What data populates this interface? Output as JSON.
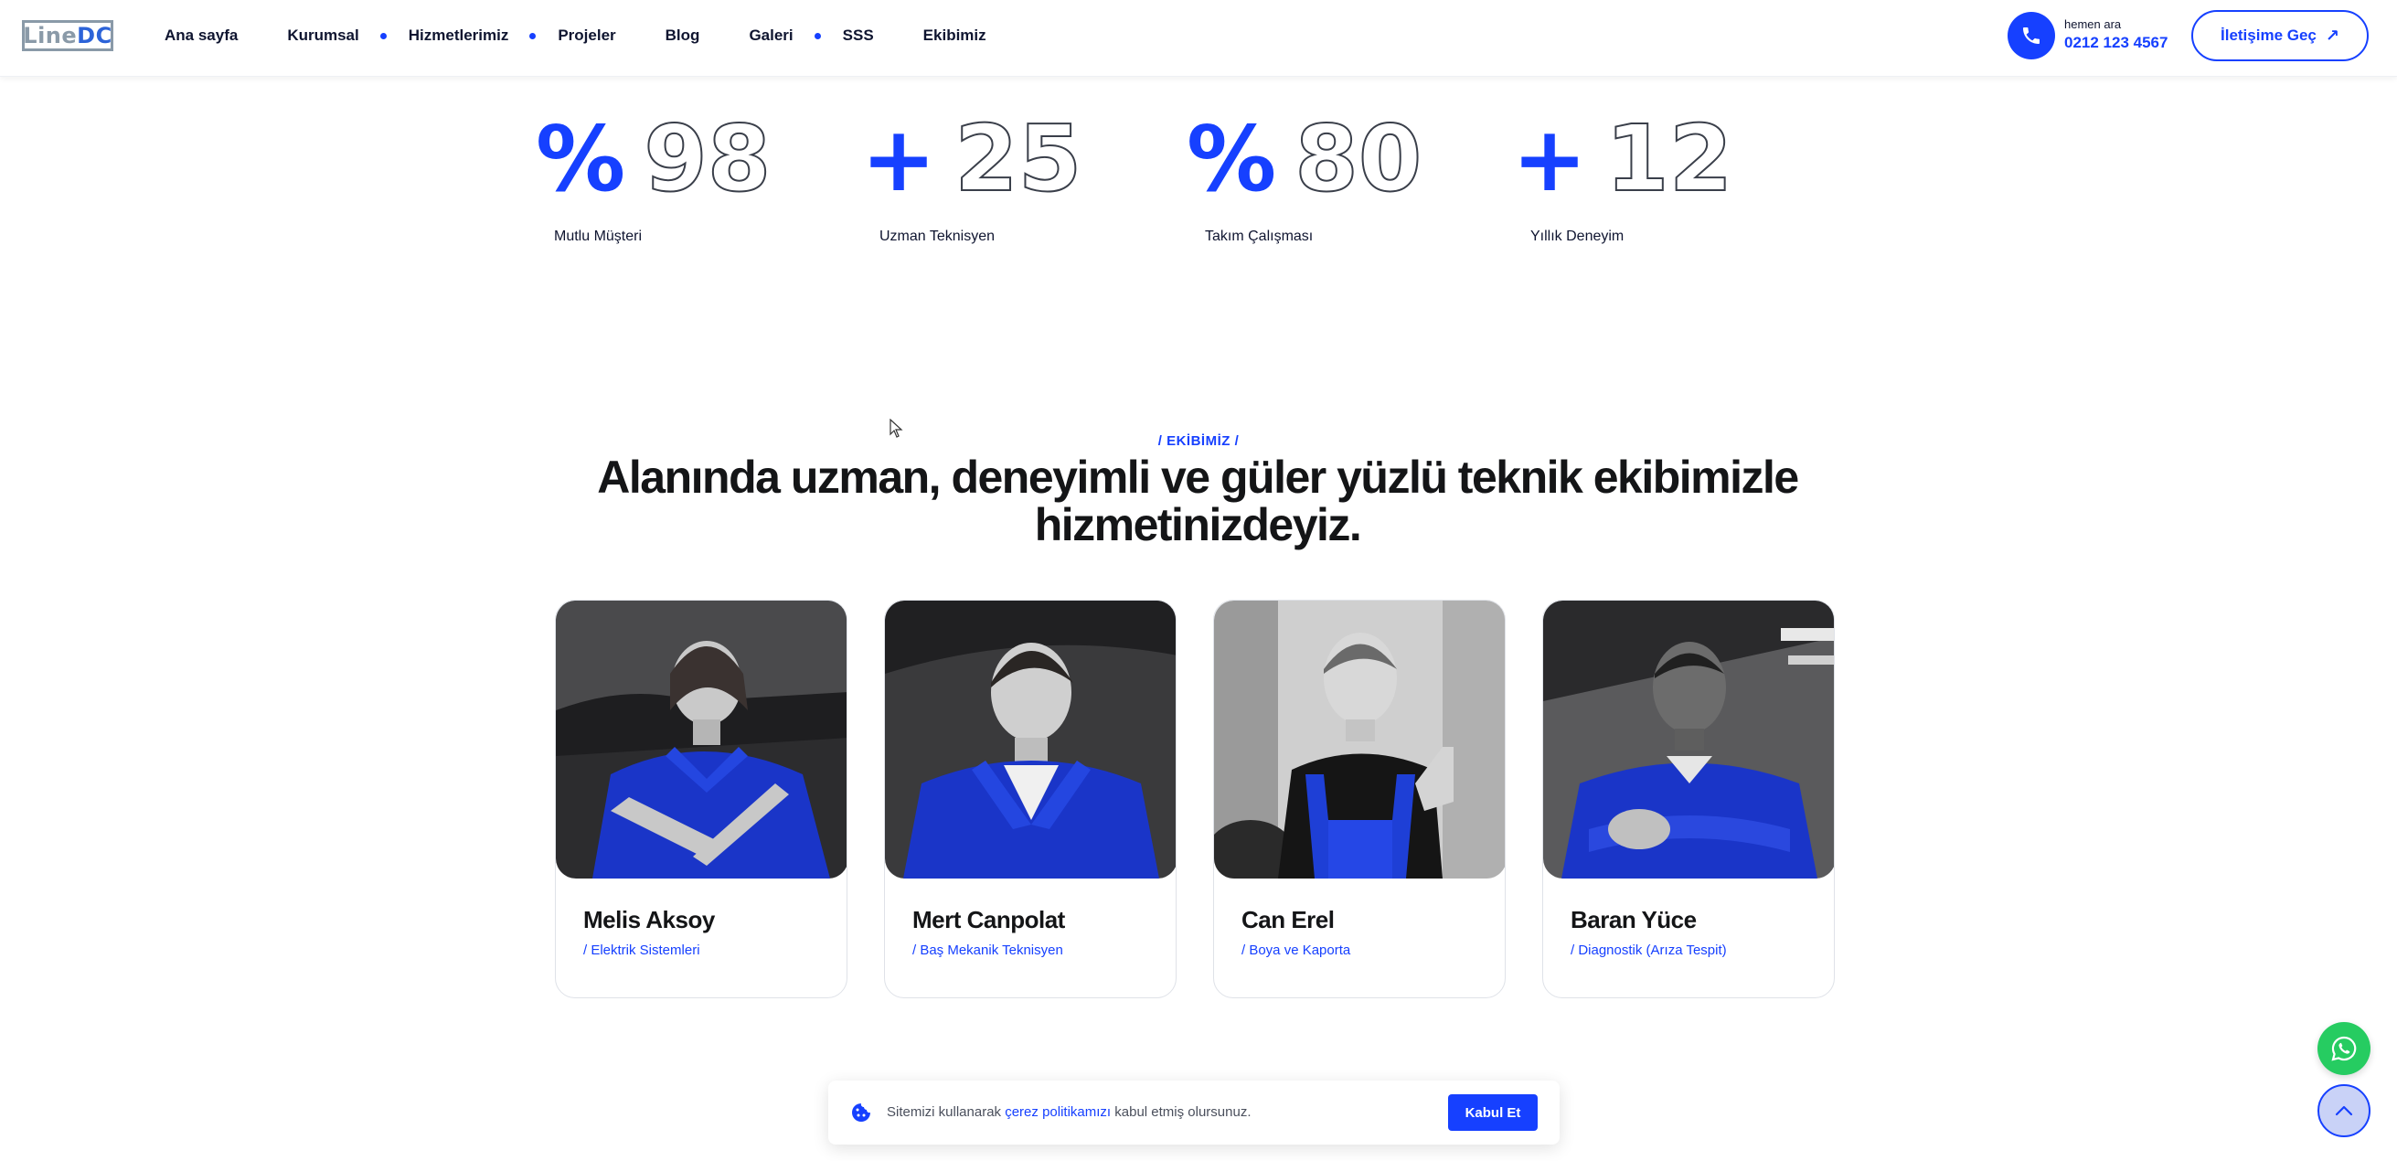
{
  "brand": {
    "logo_part1": "Line",
    "logo_part2": "DC"
  },
  "nav": {
    "items": [
      {
        "label": "Ana sayfa"
      },
      {
        "label": "Kurumsal"
      },
      {
        "label": "Hizmetlerimiz"
      },
      {
        "label": "Projeler"
      },
      {
        "label": "Blog"
      },
      {
        "label": "Galeri"
      },
      {
        "label": "SSS"
      },
      {
        "label": "Ekibimiz"
      }
    ]
  },
  "contact": {
    "call_label": "hemen ara",
    "phone": "0212 123 4567",
    "button_label": "İletişime Geç",
    "button_arrow": "↗"
  },
  "stats": [
    {
      "symbol": "%",
      "value": "98",
      "label": "Mutlu Müşteri"
    },
    {
      "symbol": "+",
      "value": "25",
      "label": "Uzman Teknisyen"
    },
    {
      "symbol": "%",
      "value": "80",
      "label": "Takım Çalışması"
    },
    {
      "symbol": "+",
      "value": "12",
      "label": "Yıllık Deneyim"
    }
  ],
  "team_section": {
    "eyebrow": "/ EKİBİMİZ /",
    "headline": "Alanında uzman, deneyimli ve güler yüzlü teknik ekibimizle hizmetinizdeyiz.",
    "members": [
      {
        "name": "Melis Aksoy",
        "role": "/ Elektrik Sistemleri"
      },
      {
        "name": "Mert Canpolat",
        "role": "/ Baş Mekanik Teknisyen"
      },
      {
        "name": "Can Erel",
        "role": "/ Boya ve Kaporta"
      },
      {
        "name": "Baran Yüce",
        "role": "/ Diagnostik (Arıza Tespit)"
      }
    ]
  },
  "cookie": {
    "text_before": "Sitemizi kullanarak ",
    "link": "çerez politikamızı",
    "text_after": " kabul etmiş olursunuz.",
    "accept": "Kabul Et"
  },
  "colors": {
    "accent": "#1640ff",
    "whatsapp": "#26cc61",
    "text": "#141517"
  },
  "icons": {
    "phone": "phone-icon",
    "whatsapp": "whatsapp-icon",
    "scroll_top": "chevron-up-icon",
    "cookie": "cookie-icon",
    "cursor": "mouse-cursor-icon"
  }
}
